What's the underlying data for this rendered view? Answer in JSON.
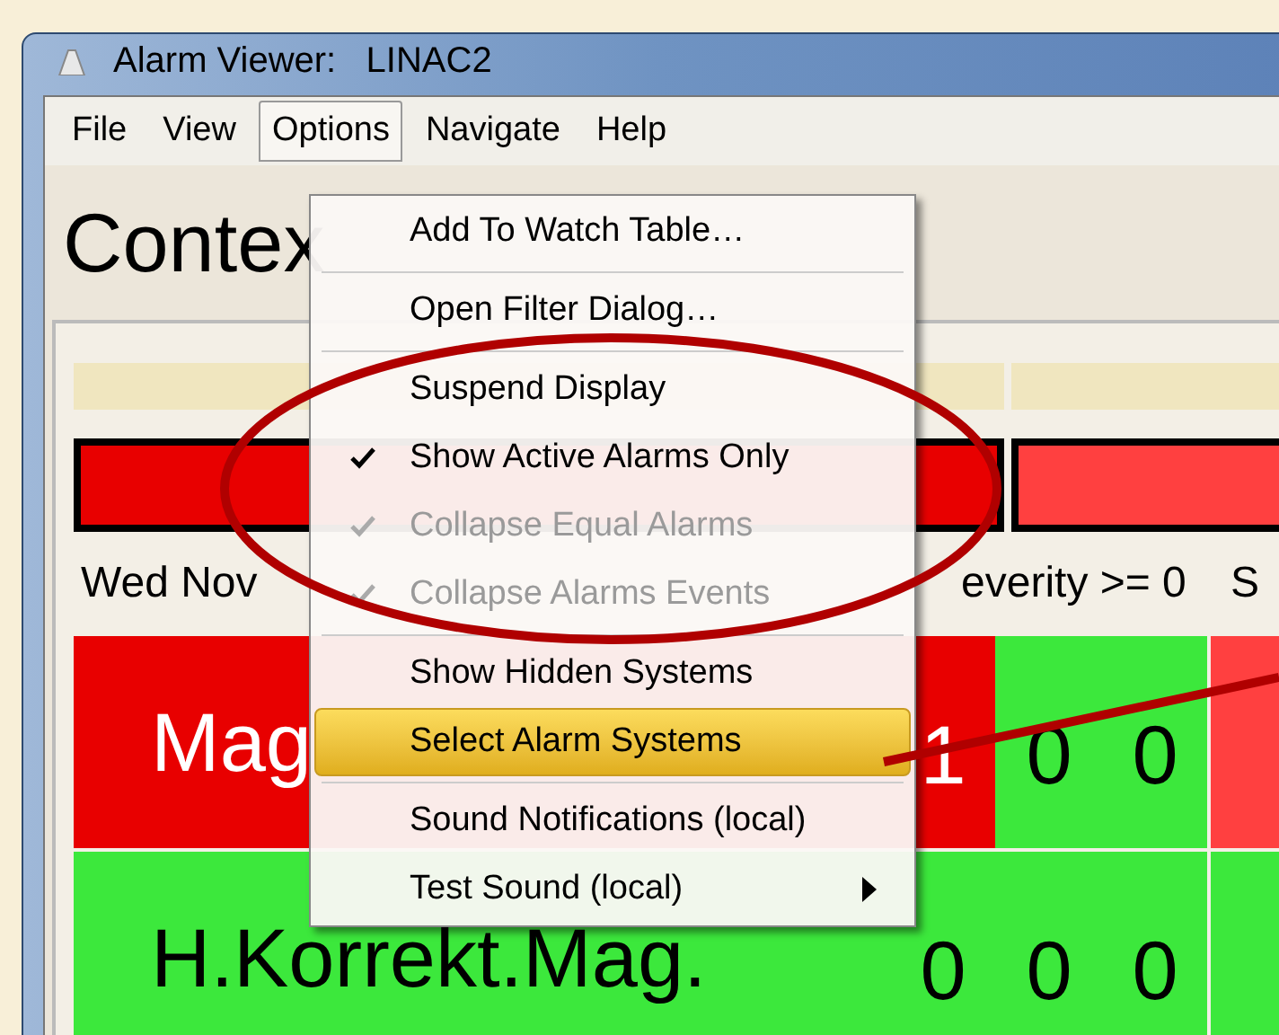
{
  "window": {
    "title": "Alarm Viewer:   LINAC2"
  },
  "menu_bar": [
    {
      "label": "File",
      "selected": false
    },
    {
      "label": "View",
      "selected": false
    },
    {
      "label": "Options",
      "selected": true
    },
    {
      "label": "Navigate",
      "selected": false
    },
    {
      "label": "Help",
      "selected": false
    }
  ],
  "options_menu": [
    {
      "kind": "item",
      "label": "Add To Watch Table…",
      "checked": false,
      "disabled": false,
      "selected": false,
      "submenu": false
    },
    {
      "kind": "separator"
    },
    {
      "kind": "item",
      "label": "Open Filter Dialog…",
      "checked": false,
      "disabled": false,
      "selected": false,
      "submenu": false
    },
    {
      "kind": "separator"
    },
    {
      "kind": "item",
      "label": "Suspend Display",
      "checked": false,
      "disabled": false,
      "selected": false,
      "submenu": false
    },
    {
      "kind": "item",
      "label": "Show Active Alarms Only",
      "checked": true,
      "disabled": false,
      "selected": false,
      "submenu": false
    },
    {
      "kind": "item",
      "label": "Collapse Equal Alarms",
      "checked": true,
      "disabled": true,
      "selected": false,
      "submenu": false
    },
    {
      "kind": "item",
      "label": "Collapse Alarms Events",
      "checked": true,
      "disabled": true,
      "selected": false,
      "submenu": false
    },
    {
      "kind": "separator"
    },
    {
      "kind": "item",
      "label": "Show Hidden Systems",
      "checked": false,
      "disabled": false,
      "selected": false,
      "submenu": false
    },
    {
      "kind": "item",
      "label": "Select Alarm Systems",
      "checked": false,
      "disabled": false,
      "selected": true,
      "submenu": false
    },
    {
      "kind": "separator"
    },
    {
      "kind": "item",
      "label": "Sound Notifications (local)",
      "checked": false,
      "disabled": false,
      "selected": false,
      "submenu": false
    },
    {
      "kind": "item",
      "label": "Test Sound (local)",
      "checked": false,
      "disabled": false,
      "selected": false,
      "submenu": true
    }
  ],
  "heading": "Contex",
  "status_bars": [
    {
      "color": "#e80000"
    },
    {
      "color": "#ff4040"
    }
  ],
  "info_line": {
    "date": "Wed Nov",
    "filter": "everity >= 0",
    "column_3": "S"
  },
  "rows": [
    {
      "name": "Mag",
      "alarm": true,
      "cells": [
        {
          "text": "1",
          "color": "#e80000"
        },
        {
          "text": "0",
          "color": "#3ce83c"
        },
        {
          "text": "0",
          "color": "#3ce83c"
        },
        {
          "color": "#ff4040"
        }
      ]
    },
    {
      "name": "H.Korrekt.Mag.",
      "alarm": false,
      "cells": [
        {
          "text": "0",
          "color": "#3ce83c"
        },
        {
          "text": "0",
          "color": "#3ce83c"
        },
        {
          "text": "0",
          "color": "#3ce83c"
        },
        {
          "color": "#3ce83c"
        }
      ]
    }
  ]
}
